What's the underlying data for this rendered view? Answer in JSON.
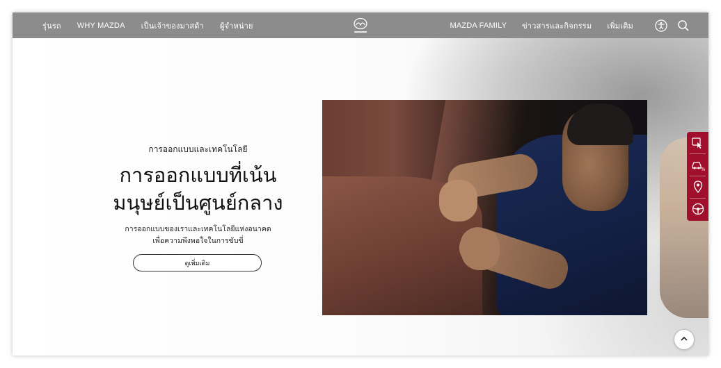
{
  "nav": {
    "left": [
      "รุ่นรถ",
      "WHY MAZDA",
      "เป็นเจ้าของมาสด้า",
      "ผู้จำหน่าย"
    ],
    "right": [
      "MAZDA FAMILY",
      "ข่าวสารและกิจกรรม",
      "เพิ่มเติม"
    ],
    "logo_icon": "mazda-logo-icon",
    "accessibility_icon": "accessibility-icon",
    "search_icon": "search-icon"
  },
  "hero": {
    "eyebrow": "การออกแบบและเทคโนโลยี",
    "headline_line1": "การออกแบบที่เน้น",
    "headline_line2": "มนุษย์เป็นศูนย์กลาง",
    "desc_line1": "การออกแบบของเราและเทคโนโลยีแห่งอนาคต",
    "desc_line2": "เพื่อความพึงพอใจในการขับขี่",
    "cta": "ดูเพิ่มเติม"
  },
  "side_tools": [
    "test-drive-icon",
    "car-offer-icon",
    "location-pin-icon",
    "steering-wheel-icon"
  ],
  "colors": {
    "header_bg": "#8c8c8c",
    "side_tools_bg": "#a0102c",
    "text": "#111111"
  }
}
